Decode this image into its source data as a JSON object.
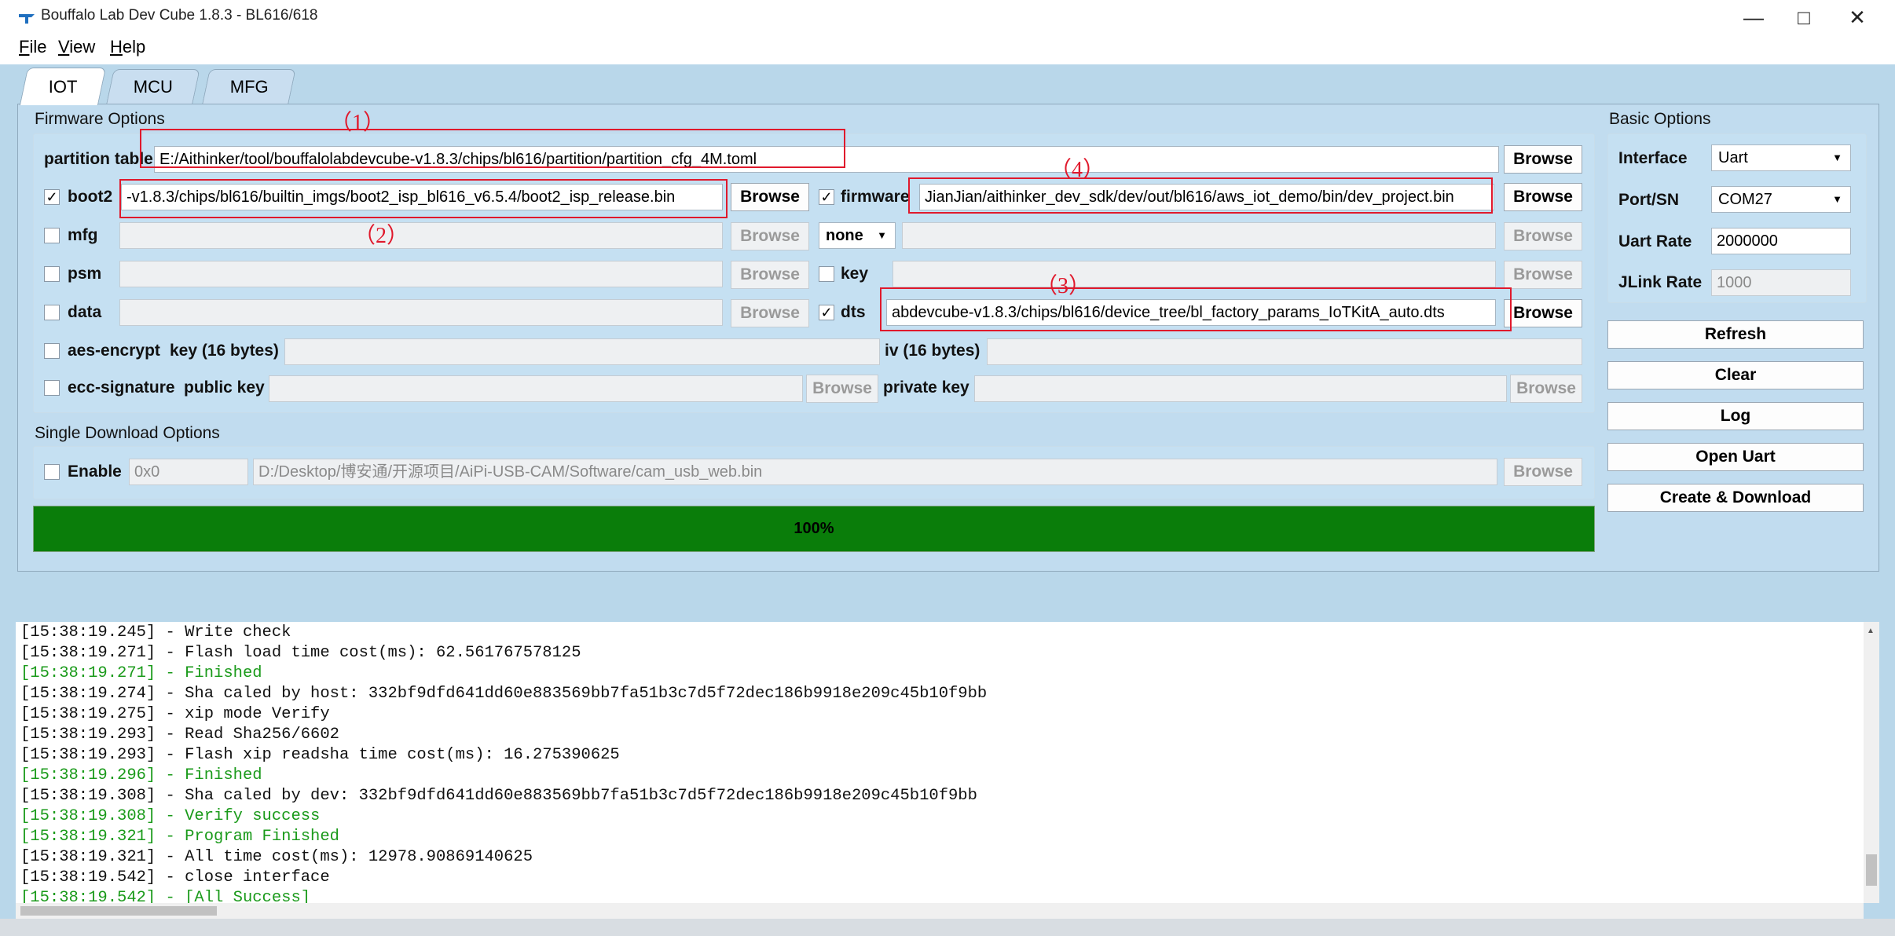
{
  "window": {
    "title": "Bouffalo Lab Dev Cube 1.8.3 - BL616/618",
    "controls": {
      "minimize": "—",
      "maximize": "□",
      "close": "✕"
    }
  },
  "menu": {
    "file": {
      "key": "F",
      "rest": "ile"
    },
    "view": {
      "key": "V",
      "rest": "iew"
    },
    "help": {
      "key": "H",
      "rest": "elp"
    }
  },
  "tabs": [
    "IOT",
    "MCU",
    "MFG"
  ],
  "firmware_options": {
    "title": "Firmware Options",
    "partition_table": {
      "label": "partition table",
      "value": "E:/Aithinker/tool/bouffalolabdevcube-v1.8.3/chips/bl616/partition/partition_cfg_4M.toml",
      "button": "Browse"
    },
    "boot2": {
      "label": "boot2",
      "checked": "✓",
      "value": "-v1.8.3/chips/bl616/builtin_imgs/boot2_isp_bl616_v6.5.4/boot2_isp_release.bin",
      "button": "Browse"
    },
    "firmware": {
      "label": "firmware",
      "checked": "✓",
      "value": "JianJian/aithinker_dev_sdk/dev/out/bl616/aws_iot_demo/bin/dev_project.bin",
      "button": "Browse"
    },
    "mfg": {
      "label": "mfg",
      "value": "",
      "button": "Browse",
      "select": "none",
      "select_arrow": "▼",
      "right_value": "",
      "right_button": "Browse"
    },
    "psm": {
      "label": "psm",
      "value": "",
      "button": "Browse"
    },
    "key": {
      "label": "key",
      "value": "",
      "button": "Browse"
    },
    "data": {
      "label": "data",
      "value": "",
      "button": "Browse"
    },
    "dts": {
      "label": "dts",
      "checked": "✓",
      "value": "abdevcube-v1.8.3/chips/bl616/device_tree/bl_factory_params_IoTKitA_auto.dts",
      "button": "Browse"
    },
    "aes": {
      "label": "aes-encrypt",
      "key_label": "key (16 bytes)",
      "key_value": "",
      "iv_label": "iv (16 bytes)",
      "iv_value": ""
    },
    "ecc": {
      "label": "ecc-signature",
      "public_label": "public key",
      "public_value": "",
      "button": "Browse",
      "private_label": "private key",
      "private_value": "",
      "private_button": "Browse"
    }
  },
  "single_download": {
    "title": "Single Download Options",
    "enable_label": "Enable",
    "address": "0x0",
    "path": "D:/Desktop/博安通/开源项目/AiPi-USB-CAM/Software/cam_usb_web.bin",
    "button": "Browse"
  },
  "progress": {
    "percent": 100,
    "label": "100%"
  },
  "basic_options": {
    "title": "Basic Options",
    "interface": {
      "label": "Interface",
      "value": "Uart"
    },
    "port": {
      "label": "Port/SN",
      "value": "COM27"
    },
    "uart_rate": {
      "label": "Uart Rate",
      "value": "2000000"
    },
    "jlink_rate": {
      "label": "JLink Rate",
      "value": "1000"
    },
    "dropdown_arrow": "▼",
    "buttons": {
      "refresh": "Refresh",
      "clear": "Clear",
      "log": "Log",
      "open_uart": "Open Uart",
      "create_download": "Create & Download"
    }
  },
  "annotations": {
    "a1": "（1）",
    "a2": "（2）",
    "a3": "（3）",
    "a4": "（4）"
  },
  "log": [
    {
      "text": "[15:38:19.245] - Write check",
      "color": "black"
    },
    {
      "text": "[15:38:19.271] - Flash load time cost(ms): 62.561767578125",
      "color": "black"
    },
    {
      "text": "[15:38:19.271] - Finished",
      "color": "green"
    },
    {
      "text": "[15:38:19.274] - Sha caled by host: 332bf9dfd641dd60e883569bb7fa51b3c7d5f72dec186b9918e209c45b10f9bb",
      "color": "black"
    },
    {
      "text": "[15:38:19.275] - xip mode Verify",
      "color": "black"
    },
    {
      "text": "[15:38:19.293] - Read Sha256/6602",
      "color": "black"
    },
    {
      "text": "[15:38:19.293] - Flash xip readsha time cost(ms): 16.275390625",
      "color": "black"
    },
    {
      "text": "[15:38:19.296] - Finished",
      "color": "green"
    },
    {
      "text": "[15:38:19.308] - Sha caled by dev: 332bf9dfd641dd60e883569bb7fa51b3c7d5f72dec186b9918e209c45b10f9bb",
      "color": "black"
    },
    {
      "text": "[15:38:19.308] - Verify success",
      "color": "green"
    },
    {
      "text": "[15:38:19.321] - Program Finished",
      "color": "green"
    },
    {
      "text": "[15:38:19.321] - All time cost(ms): 12978.90869140625",
      "color": "black"
    },
    {
      "text": "[15:38:19.542] - close interface",
      "color": "black"
    },
    {
      "text": "[15:38:19.542] - [All Success]",
      "color": "green"
    }
  ],
  "colors": {
    "accent_green": "#0a7d0a",
    "log_green": "#1a9a1a",
    "annotation_red": "#e0192c"
  }
}
